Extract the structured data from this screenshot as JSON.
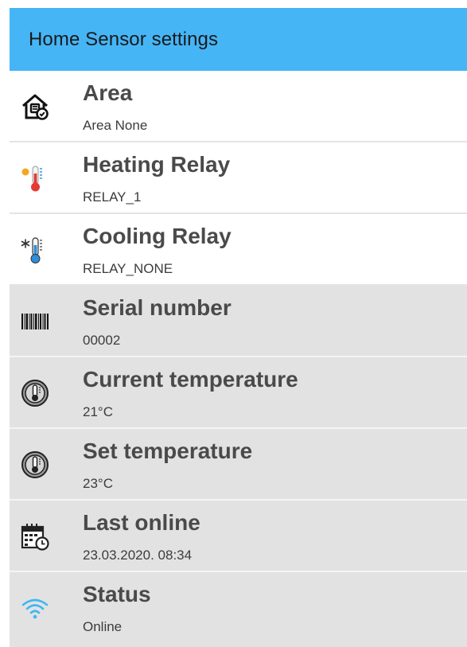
{
  "appbar": {
    "title": "Home Sensor settings",
    "color": "#45b5f6"
  },
  "settings": [
    {
      "icon": "home-settings-icon",
      "title": "Area",
      "value": "Area None"
    },
    {
      "icon": "heating-thermometer-icon",
      "title": "Heating Relay",
      "value": "RELAY_1"
    },
    {
      "icon": "cooling-thermometer-icon",
      "title": "Cooling Relay",
      "value": "RELAY_NONE"
    },
    {
      "icon": "barcode-icon",
      "title": "Serial number",
      "value": "00002"
    },
    {
      "icon": "thermostat-icon",
      "title": "Current temperature",
      "value": "21°C"
    },
    {
      "icon": "thermostat-icon",
      "title": "Set temperature",
      "value": "23°C"
    },
    {
      "icon": "calendar-clock-icon",
      "title": "Last online",
      "value": "23.03.2020. 08:34"
    },
    {
      "icon": "wifi-icon",
      "title": "Status",
      "value": "Online"
    }
  ],
  "colors": {
    "row_light": "#ffffff",
    "row_grey": "#e2e2e2",
    "heating": "#e53935",
    "sun": "#f5a623",
    "cooling": "#2d8fd8",
    "wifi": "#3fb8f0"
  }
}
